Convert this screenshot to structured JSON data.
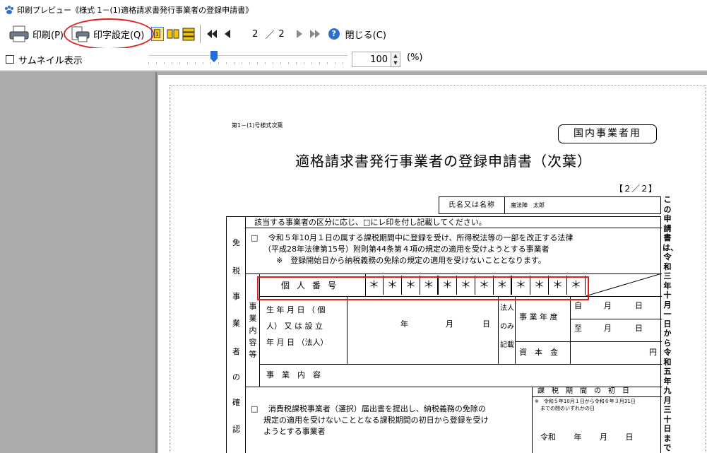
{
  "window": {
    "title": "印刷プレビュー《様式 1－(1)適格請求書発行事業者の登録申請書》"
  },
  "toolbar": {
    "print_label": "印刷(P)",
    "print_settings_label": "印字設定(Q)",
    "current_page": "2",
    "page_separator": "／",
    "total_pages": "2",
    "close_label": "閉じる(C)"
  },
  "view": {
    "thumbnail_label": "サムネイル表示",
    "zoom_value": "100",
    "zoom_unit": "(%)",
    "zoom_slider_fraction": 0.33
  },
  "document": {
    "form_id": "第1－(1)号様式次葉",
    "domestic_box": "国内事業者用",
    "title": "適格請求書発行事業者の登録申請書（次葉）",
    "page_no": "【２／２】",
    "name_label": "氏名又は名称",
    "name_value": "魔法陣　太郎",
    "instruction": "該当する事業者の区分に応じ、□にレ印を付し記載してください。",
    "side_chars": [
      "免",
      "税",
      "事",
      "業",
      "者",
      "の",
      "確",
      "認"
    ],
    "option1_line1": "□　 令和５年10月１日の属する課税期間中に登録を受け、所得税法等の一部を改正する法律",
    "option1_line2": "（平成28年法律第15号）附則第44条第４項の規定の適用を受けようとする事業者",
    "option1_line3": "※　登録開始日から納税義務の免除の規定の適用を受けないこととなります。",
    "kojin_label": "個人番号",
    "mynumber": [
      "＊",
      "＊",
      "＊",
      "＊",
      "＊",
      "＊",
      "＊",
      "＊",
      "＊",
      "＊",
      "＊",
      "＊"
    ],
    "jigyo_chars": [
      "事",
      "業",
      "内",
      "容",
      "等"
    ],
    "birth_line1": "生 年 月 日 （ 個",
    "birth_line2": "人） 又 は 設 立",
    "birth_line3": "年 月 日 （法人）",
    "date_year": "年",
    "date_month": "月",
    "date_day": "日",
    "hojin_line1": "法人",
    "hojin_line2": "のみ",
    "hojin_line3": "記載",
    "fiscal_year": "事 業 年 度",
    "from_label": "自",
    "to_label": "至",
    "month": "月",
    "day": "日",
    "capital": "資　本　金",
    "yen": "円",
    "business_content": "事　業　内　容",
    "option2_line1": "□　 消費税課税事業者（選択）届出書を提出し、納税義務の免除の",
    "option2_line2": "規定の適用を受けないこととなる課税期間の初日から登録を受け",
    "option2_line3": "ようとする事業者",
    "tax_period_label": "課　税　期　間　の　初　日",
    "tax_period_note1": "※　令和５年10月１日から令和６年３月31日",
    "tax_period_note2": "までの間のいずれかの日",
    "reiwa_line": "令和　　 年　　 月　　 日",
    "vertical_text": "この申請書は、令和三年十月一日から令和五年九月三十日まで"
  },
  "colors": {
    "highlight_red": "#e02020",
    "preview_bg": "#ababab"
  }
}
